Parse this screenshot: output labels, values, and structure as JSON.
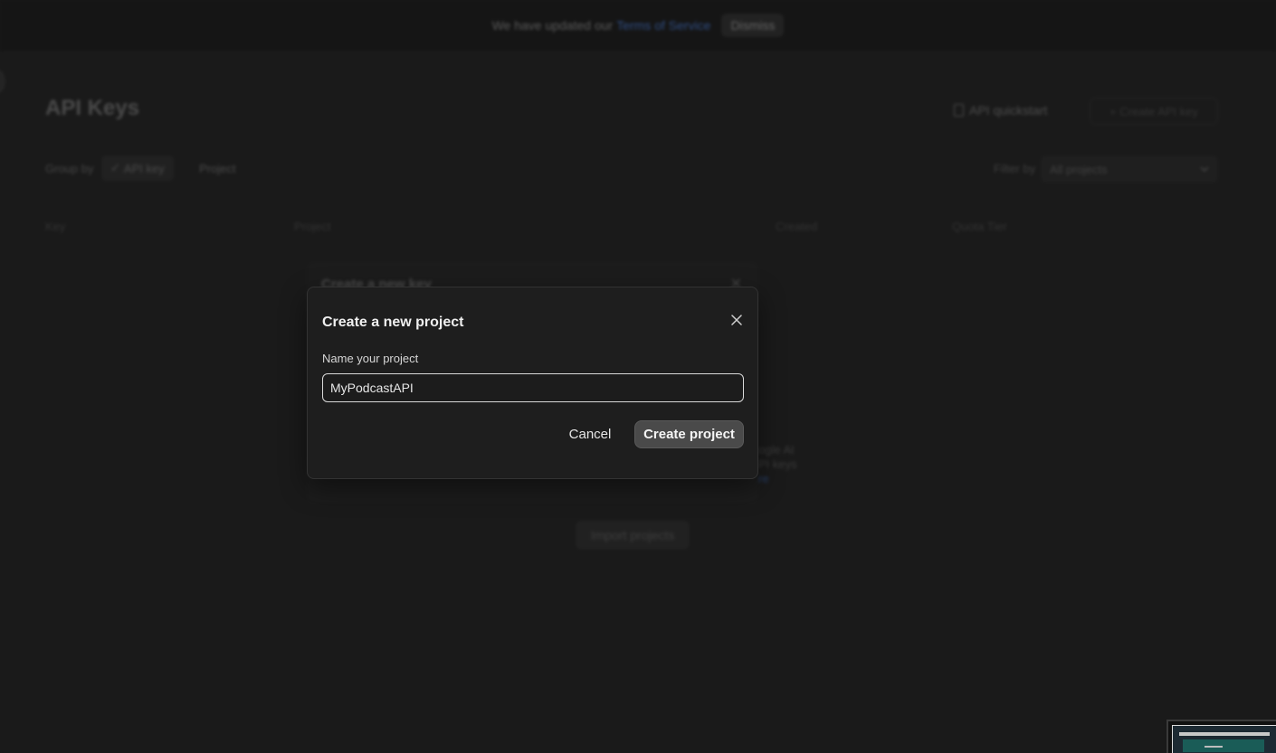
{
  "banner": {
    "text": "We have updated our",
    "link": "Terms of Service",
    "dismiss": "Dismiss"
  },
  "page": {
    "title": "API Keys",
    "quickstart": "API quickstart",
    "create_key": "+ Create API key",
    "group_by_label": "Group by",
    "group_api_key": "API key",
    "group_project": "Project",
    "filter_label": "Filter by",
    "filter_value": "All projects",
    "columns": [
      "Key",
      "Project",
      "Created",
      "Quota Tier"
    ],
    "import_projects": "Import projects"
  },
  "key_modal": {
    "title": "Create a new key"
  },
  "bg_hint": {
    "line1": "ogle AI",
    "line2": "PI keys",
    "line3": "re"
  },
  "modal": {
    "title": "Create a new project",
    "field_label": "Name your project",
    "input_value": "MyPodcastAPI",
    "cancel": "Cancel",
    "create": "Create project"
  },
  "icons": {
    "close": "close-icon",
    "doc": "doc-icon",
    "chevron": "chevron-down-icon"
  }
}
